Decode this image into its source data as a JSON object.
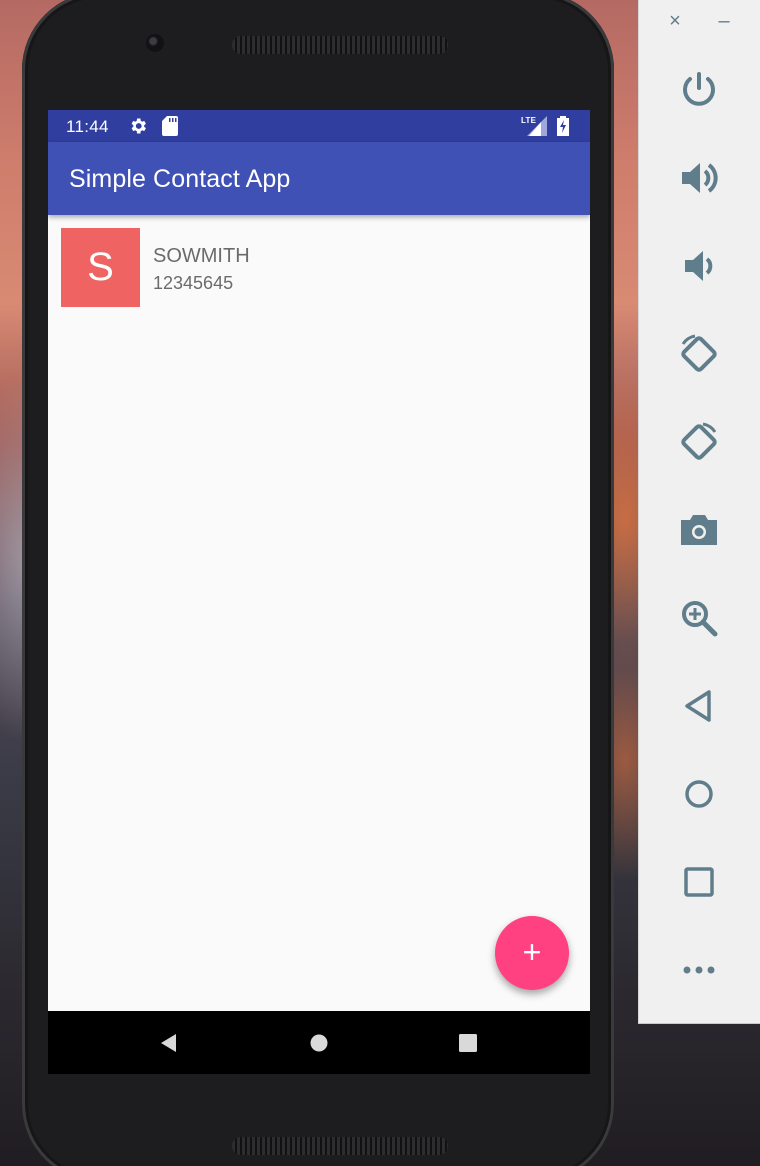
{
  "status_bar": {
    "time": "11:44",
    "network_label": "LTE",
    "icons": [
      "gear-icon",
      "sd-card-icon",
      "lte-signal-icon",
      "battery-charging-icon"
    ]
  },
  "app_bar": {
    "title": "Simple Contact App"
  },
  "contacts": [
    {
      "initial": "S",
      "name": "SOWMITH",
      "number": "12345645",
      "avatar_color": "#ef6363"
    }
  ],
  "fab": {
    "label": "+",
    "color": "#ff4081"
  },
  "nav_bar": {
    "icons": [
      "back-icon",
      "home-icon",
      "recent-apps-icon"
    ]
  },
  "emulator_toolbar": {
    "window_controls": [
      "×",
      "–"
    ],
    "buttons": [
      "power-icon",
      "volume-up-icon",
      "volume-down-icon",
      "rotate-left-icon",
      "rotate-right-icon",
      "camera-icon",
      "zoom-icon",
      "back-icon",
      "home-icon",
      "overview-icon",
      "more-icon"
    ]
  },
  "colors": {
    "status_bar": "#303f9f",
    "app_bar": "#3f51b5",
    "accent": "#ff4081",
    "toolbar_icon": "#607d8b"
  }
}
